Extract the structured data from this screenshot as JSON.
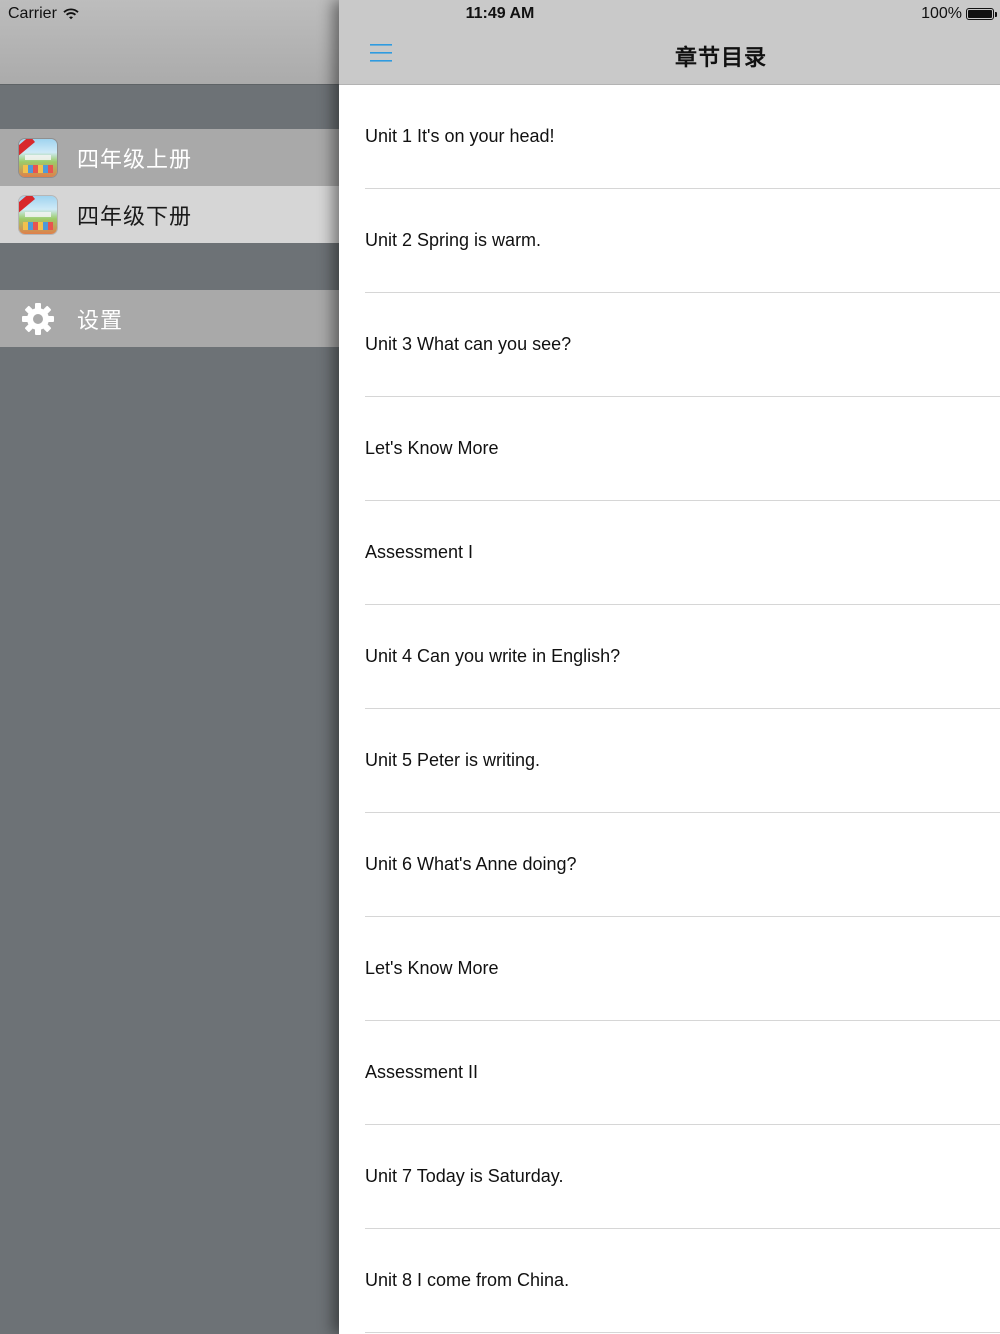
{
  "status_bar": {
    "carrier": "Carrier",
    "time": "11:49 AM",
    "battery": "100%"
  },
  "drawer": {
    "books": [
      {
        "label": "四年级上册",
        "selected": false
      },
      {
        "label": "四年级下册",
        "selected": true
      }
    ],
    "settings_label": "设置"
  },
  "navbar": {
    "menu_icon": "hamburger-menu-icon",
    "title": "章节目录"
  },
  "chapters": [
    "Unit 1 It's on your head!",
    "Unit 2 Spring is warm.",
    "Unit 3 What can you see?",
    "Let's Know More",
    "Assessment I",
    "Unit 4 Can you write in English?",
    "Unit 5 Peter is writing.",
    "Unit 6 What's Anne doing?",
    "Let's Know More",
    "Assessment II",
    "Unit 7 Today is Saturday.",
    "Unit 8 I come from China."
  ],
  "colors": {
    "accent": "#2f9be0",
    "drawer_bg": "#6d7276",
    "selected_row": "#d6d6d6"
  }
}
